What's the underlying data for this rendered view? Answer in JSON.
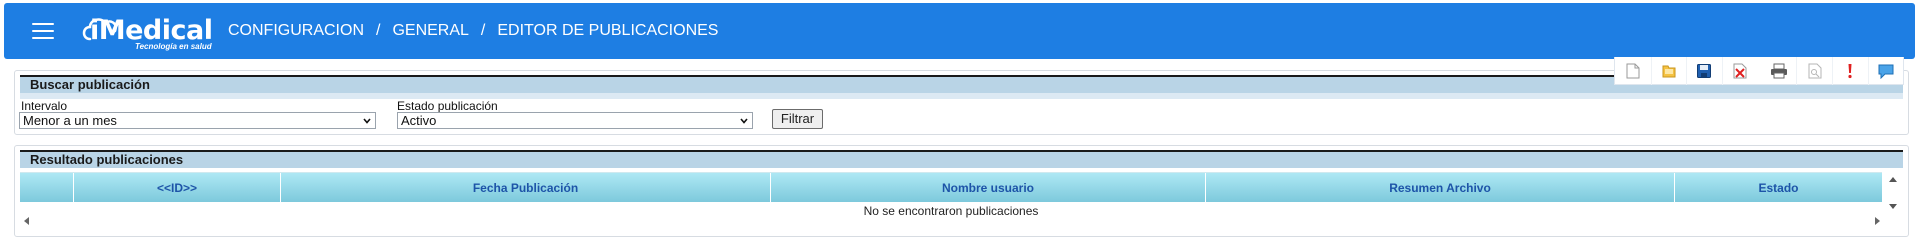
{
  "header": {
    "logo_text": "iMedical",
    "logo_tagline": "Tecnología en salud",
    "breadcrumb": [
      "CONFIGURACION",
      "GENERAL",
      "EDITOR DE PUBLICACIONES"
    ],
    "separator": "/"
  },
  "toolbar": {
    "icons": [
      "new-document-icon",
      "folder-icon",
      "save-icon",
      "delete-icon",
      "print-icon",
      "preview-icon",
      "alert-icon",
      "chat-icon"
    ]
  },
  "search_panel": {
    "title": "Buscar publicación",
    "interval_label": "Intervalo",
    "interval_value": "Menor a un mes",
    "status_label": "Estado publicación",
    "status_value": "Activo",
    "filter_button": "Filtrar"
  },
  "result_panel": {
    "title": "Resultado publicaciones",
    "columns": [
      "",
      "<<ID>>",
      "Fecha Publicación",
      "Nombre usuario",
      "Resumen Archivo",
      "Estado"
    ],
    "empty_message": "No se encontraron publicaciones"
  },
  "colors": {
    "header_bg": "#1e7ee3",
    "panel_header_bg": "#b9d4e6",
    "grid_header_bg": "#7dc9dc",
    "grid_header_text": "#1d54a8"
  }
}
